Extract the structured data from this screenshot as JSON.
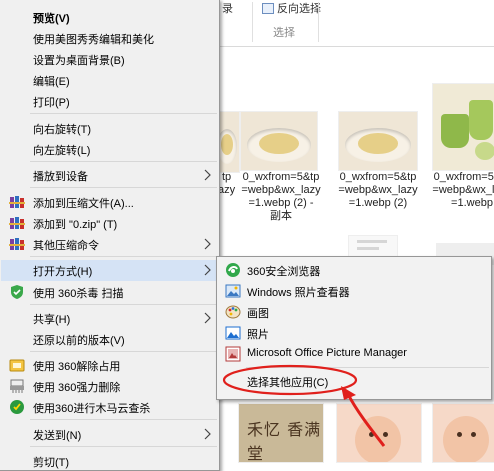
{
  "ribbon": {
    "group1_button": "录",
    "group2_button": "反向选择",
    "group2_label": "选择"
  },
  "thumbnails": [
    {
      "caption": "0_wxfrom=5&tp\n=webp&wx_lazy\n=1.webp (2) -\n副本",
      "kind": "bowl"
    },
    {
      "caption": "0_wxfrom=5&tp\n=webp&wx_lazy\n=1.webp (2)",
      "kind": "bowl"
    },
    {
      "caption": "0_wxfrom=5&tp\n=webp&wx_lazy\n=1.webp",
      "kind": "green"
    },
    {
      "caption": "tp\nazy",
      "kind": "bowl"
    },
    {
      "caption": "",
      "kind": "document"
    },
    {
      "caption": "",
      "kind": "calligraphy",
      "ink_text": "禾忆 香满堂"
    },
    {
      "caption": "",
      "kind": "baby"
    }
  ],
  "main_menu": {
    "items": [
      {
        "label": "预览(V)",
        "bold": true
      },
      {
        "label": "使用美图秀秀编辑和美化"
      },
      {
        "label": "设置为桌面背景(B)"
      },
      {
        "label": "编辑(E)"
      },
      {
        "label": "打印(P)"
      },
      {
        "label": "向右旋转(T)"
      },
      {
        "label": "向左旋转(L)"
      },
      {
        "label": "播放到设备"
      },
      {
        "label": "添加到压缩文件(A)..."
      },
      {
        "label": "添加到 \"0.zip\" (T)"
      },
      {
        "label": "其他压缩命令"
      },
      {
        "label": "打开方式(H)"
      },
      {
        "label": "使用 360杀毒 扫描"
      },
      {
        "label": "共享(H)"
      },
      {
        "label": "还原以前的版本(V)"
      },
      {
        "label": "使用 360解除占用"
      },
      {
        "label": "使用 360强力删除"
      },
      {
        "label": "使用360进行木马云查杀"
      },
      {
        "label": "发送到(N)"
      },
      {
        "label": "剪切(T)"
      }
    ]
  },
  "open_with_menu": {
    "items": [
      {
        "label": "360安全浏览器"
      },
      {
        "label": "Windows 照片查看器"
      },
      {
        "label": "画图"
      },
      {
        "label": "照片"
      },
      {
        "label": "Microsoft Office Picture Manager"
      },
      {
        "label": "选择其他应用(C)"
      }
    ]
  },
  "colors": {
    "menu_bg": "#f0f0f0",
    "highlight": "#d5e3f5",
    "annotation": "#e0201c"
  },
  "icons": {
    "compress": "winrar-books-icon",
    "antivirus": "360-shield-icon",
    "browser": "360-browser-icon",
    "photo_viewer": "windows-photo-viewer-icon",
    "paint": "paint-palette-icon",
    "photos": "photos-app-icon",
    "picture_manager": "office-picture-manager-icon"
  }
}
